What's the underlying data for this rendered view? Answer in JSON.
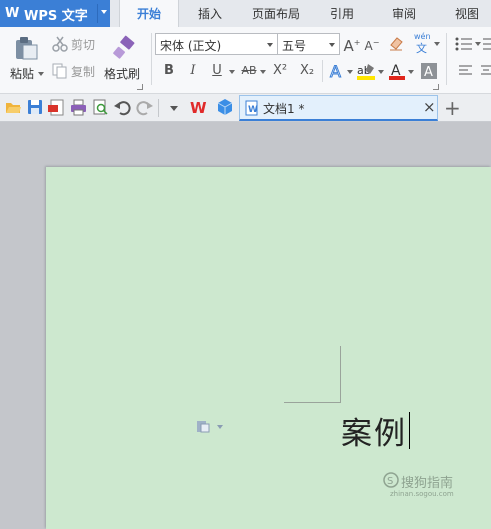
{
  "app": {
    "name": "WPS 文字",
    "logo": "W"
  },
  "tabs": [
    "开始",
    "插入",
    "页面布局",
    "引用",
    "审阅",
    "视图"
  ],
  "active_tab": "开始",
  "ribbon": {
    "paste_label": "粘贴",
    "cut_label": "剪切",
    "copy_label": "复制",
    "format_painter_label": "格式刷",
    "font_name": "宋体 (正文)",
    "font_size": "五号",
    "bold": "B",
    "italic": "I",
    "underline": "U",
    "strikethrough": "AB",
    "superscript": "X²",
    "subscript": "X₂",
    "pinyin_top": "wén",
    "pinyin_bottom": "文",
    "grow_font": "A",
    "shrink_font": "A"
  },
  "document_tab": {
    "title": "文档1 *",
    "close": "×"
  },
  "new_tab": "+",
  "document": {
    "text": "案例"
  },
  "watermark": {
    "brand": "搜狗指南",
    "url": "zhinan.sogou.com"
  },
  "colors": {
    "accent": "#3b7fd6",
    "page_bg": "#cde8cf",
    "app_bg": "#c4c6cb"
  }
}
